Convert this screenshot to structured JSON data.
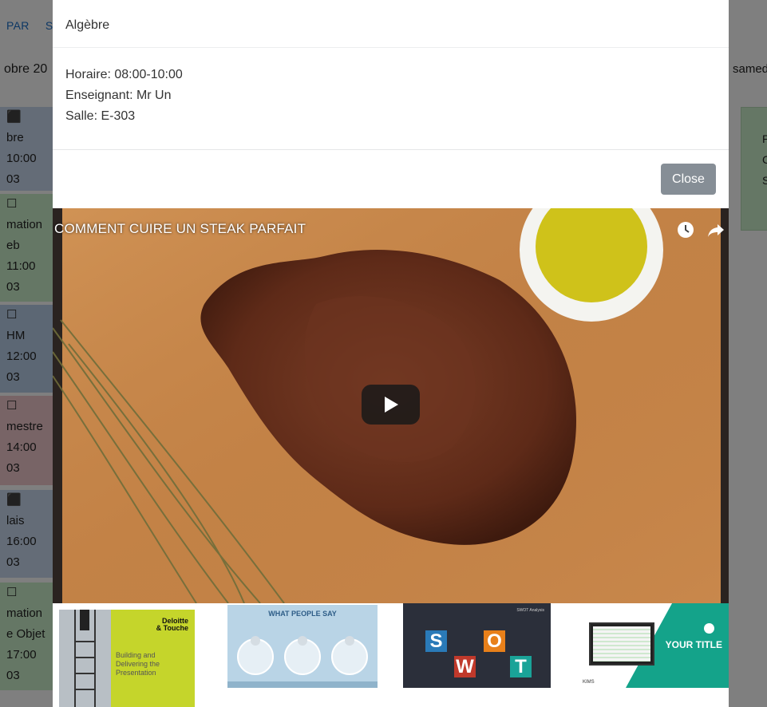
{
  "background": {
    "nav_items": [
      "PAR",
      "S"
    ],
    "left_date": "obre 20",
    "right_date": "samed",
    "cards": [
      {
        "color": "#c9d9ee",
        "lines": [
          "⬛",
          "bre",
          "10:00",
          "03"
        ]
      },
      {
        "color": "#cbeecb",
        "lines": [
          "☐",
          "mation",
          "eb",
          "11:00",
          "03"
        ]
      },
      {
        "color": "#b9cfe8",
        "lines": [
          "☐",
          "HM",
          "12:00",
          "03"
        ]
      },
      {
        "color": "#f0c8cc",
        "lines": [
          "☐",
          "mestre",
          "14:00",
          "03"
        ]
      },
      {
        "color": "#c9d9ee",
        "lines": [
          "⬛",
          "lais",
          "16:00",
          "03"
        ]
      },
      {
        "color": "#cbeecb",
        "lines": [
          "☐",
          "mation",
          "e Objet",
          "17:00",
          "03"
        ]
      }
    ],
    "right_card_lines": [
      "P",
      "C",
      "S"
    ]
  },
  "modal": {
    "title": "Algèbre",
    "horaire": "Horaire: 08:00-10:00",
    "enseignant": "Enseignant: Mr Un",
    "salle": "Salle: E-303",
    "close_label": "Close"
  },
  "video": {
    "title": "COMMENT CUIRE UN STEAK PARFAIT"
  },
  "thumbnails": {
    "t1_brand_line1": "Deloitte",
    "t1_brand_line2": "& Touche",
    "t1_caption": "Building and Delivering the Presentation",
    "t2_heading": "WHAT PEOPLE SAY",
    "t3_tiles": [
      {
        "letter": "S",
        "color": "#2a7ab8"
      },
      {
        "letter": "O",
        "color": "#e8801a"
      },
      {
        "letter": "W",
        "color": "#c0392b"
      },
      {
        "letter": "T",
        "color": "#1aa398"
      }
    ],
    "t3_header": "SWOT Analysis",
    "t4_title": "YOUR TITLE",
    "t4_label": "KIMS"
  },
  "colors": {
    "close_button": "#868e96",
    "overlay": "rgba(0,0,0,0.5)"
  }
}
